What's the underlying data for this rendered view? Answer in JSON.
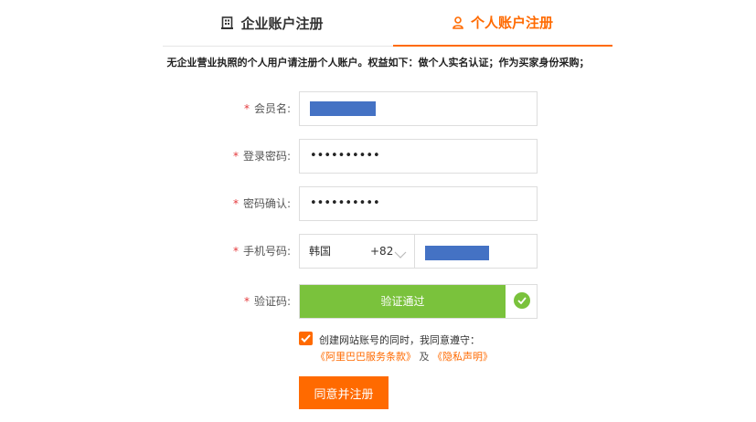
{
  "tabs": {
    "company": "企业账户注册",
    "personal": "个人账户注册"
  },
  "notice": "无企业营业执照的个人用户请注册个人账户。权益如下：做个人实名认证；作为买家身份采购；",
  "form": {
    "required_mark": "*",
    "member_name_label": "会员名:",
    "password_label": "登录密码:",
    "password_value": "••••••••••",
    "confirm_label": "密码确认:",
    "confirm_value": "••••••••••",
    "phone_label": "手机号码:",
    "country_name": "韩国",
    "country_code": "+82",
    "captcha_label": "验证码:",
    "captcha_status": "验证通过"
  },
  "agreement": {
    "checked": true,
    "text": "创建网站账号的同时，我同意遵守：",
    "link1": "《阿里巴巴服务条款》",
    "conjunction": "及",
    "link2": "《隐私声明》"
  },
  "submit_label": "同意并注册",
  "colors": {
    "accent": "#ff6a00",
    "success": "#7ac23c",
    "required": "#e4393c",
    "redaction": "#4472c4"
  },
  "icons": {
    "company_tab": "building-icon",
    "personal_tab": "user-icon",
    "country_dropdown": "chevron-down-icon",
    "captcha_ok": "check-circle-icon",
    "agree_checkbox": "checkmark-icon"
  }
}
